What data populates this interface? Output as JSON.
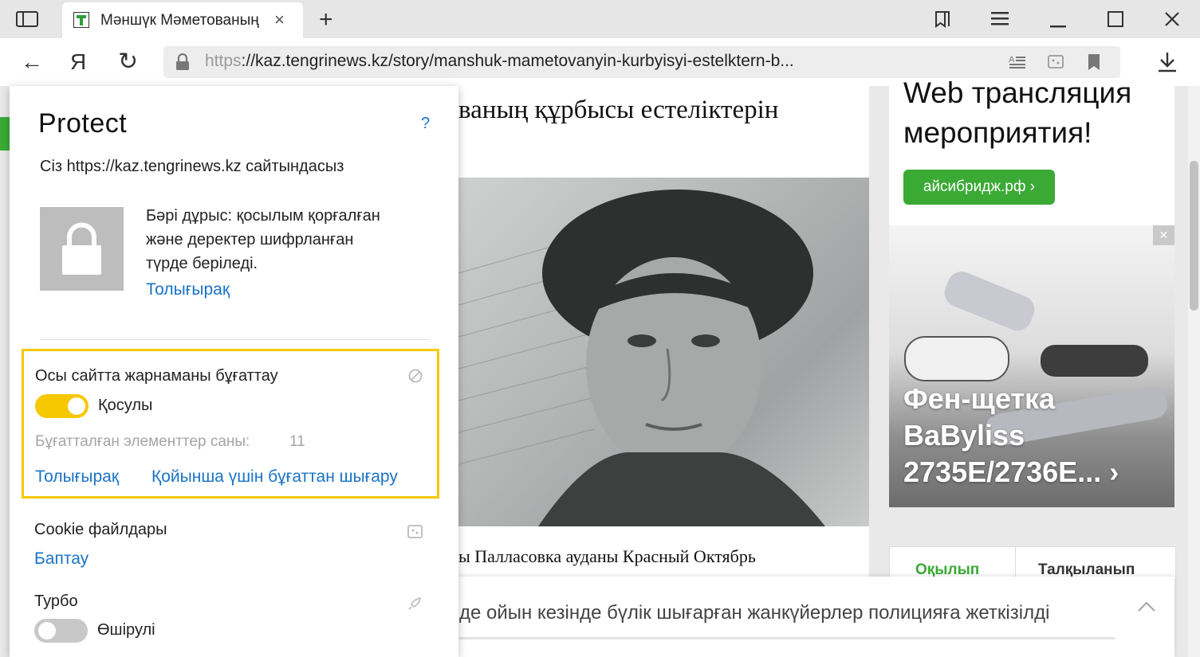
{
  "tab": {
    "title": "Мәншүк Мәметованың",
    "close": "×",
    "new_tab": "+"
  },
  "toolbar": {
    "back": "←",
    "yandex": "Я",
    "reload": "↻",
    "url_scheme": "https",
    "url_rest": "://kaz.tengrinews.kz/story/manshuk-mametovanyin-kurbyisyi-estelktern-b..."
  },
  "article": {
    "headline": "ваның құрбысы естеліктерін",
    "caption": "ы Палласовка ауданы Красный Октябрь"
  },
  "ad": {
    "text_line1": "Web трансляция",
    "text_line2": "мероприятия!",
    "button_label": "айсибридж.рф ›",
    "close": "×",
    "product_line1": "Фен-щетка",
    "product_line2": "BaByliss",
    "product_line3": "2735E/2736E... ›"
  },
  "widget_tabs": {
    "tab1": "Оқылып",
    "tab2": "Талқыланып"
  },
  "notification": {
    "text": "де ойын кезінде бүлік шығарған жанкүйерлер полицияға жеткізілді",
    "chevron": "^"
  },
  "protect": {
    "title": "Protect",
    "help": "?",
    "site_text": "Сіз https://kaz.tengrinews.kz сайтындасыз",
    "status_line1": "Бәрі дұрыс: қосылым қорғалған",
    "status_line2": "және деректер шифрланған",
    "status_line3": "түрде беріледі.",
    "status_more": "Толығырақ",
    "adblock": {
      "label": "Осы сайтта жарнаманы бұғаттау",
      "state": "Қосулы",
      "count_label": "Бұғатталған элементтер саны:",
      "count": "11",
      "more": "Толығырақ",
      "unblock": "Қойынша үшін бұғаттан шығару"
    },
    "cookie": {
      "label": "Cookie файлдары",
      "link": "Баптау"
    },
    "turbo": {
      "label": "Турбо",
      "state": "Өшірулі"
    }
  },
  "colors": {
    "accent_yellow": "#f6c800",
    "link_blue": "#1a73c7",
    "green": "#3aaa35"
  }
}
